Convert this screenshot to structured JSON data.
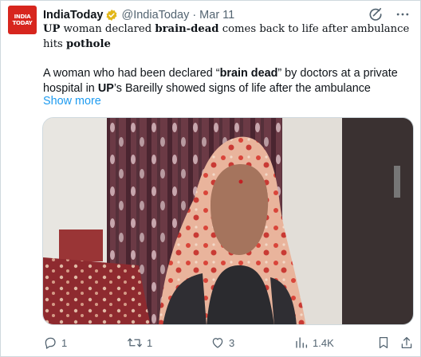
{
  "tweet": {
    "display_name": "IndiaToday",
    "handle": "@IndiaToday",
    "separator": "·",
    "date": "Mar 11",
    "avatar_line1": "INDIA",
    "avatar_line2": "TODAY",
    "headline_parts": [
      "UP",
      " woman declared ",
      "brain-dead",
      " comes back to life after ambulance hits ",
      "pothole"
    ],
    "body_parts": [
      "A woman who had been declared “",
      "brain dead",
      "” by doctors at a private hospital in ",
      "UP",
      "’s Bareilly showed signs of life after the ambulance"
    ],
    "show_more": "Show more",
    "icons": {
      "verified": "verified-badge-icon",
      "grok": "grok-icon",
      "more": "more-icon"
    }
  },
  "actions": {
    "reply_count": "1",
    "retweet_count": "1",
    "like_count": "3",
    "views_count": "1.4K"
  },
  "colors": {
    "text": "#0f1419",
    "secondary": "#536471",
    "link": "#1d9bf0",
    "verified": "#e2b719",
    "brand_red": "#d7261e"
  }
}
